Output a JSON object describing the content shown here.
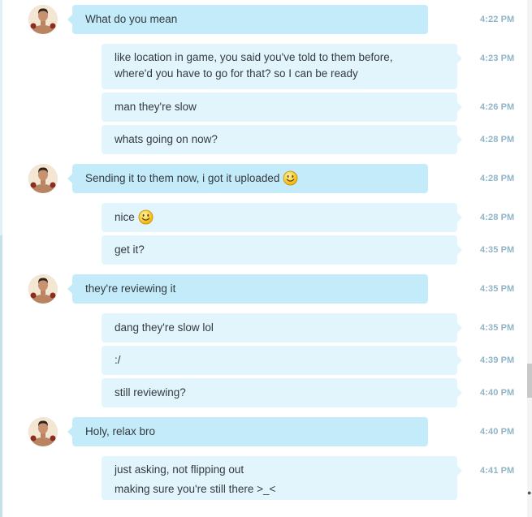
{
  "messages": [
    {
      "dir": "in",
      "time": "4:22 PM",
      "lines": [
        "What do you mean"
      ]
    },
    {
      "dir": "out",
      "time": "4:23 PM",
      "lines": [
        "like location in game, you said you've told to them before,",
        "where'd you have to go for that? so I can be ready"
      ]
    },
    {
      "dir": "out",
      "time": "4:26 PM",
      "lines": [
        "man they're slow"
      ]
    },
    {
      "dir": "out",
      "time": "4:28 PM",
      "lines": [
        "whats going on now?"
      ]
    },
    {
      "dir": "in",
      "time": "4:28 PM",
      "lines": [
        "Sending it to them now, i got it uploaded"
      ],
      "emoticon": "smile-emoticon"
    },
    {
      "dir": "out",
      "time": "4:28 PM",
      "lines": [
        "nice"
      ],
      "emoticon": "smile-emoticon"
    },
    {
      "dir": "out",
      "time": "4:35 PM",
      "lines": [
        "get it?"
      ]
    },
    {
      "dir": "in",
      "time": "4:35 PM",
      "lines": [
        "they're reviewing it"
      ]
    },
    {
      "dir": "out",
      "time": "4:35 PM",
      "lines": [
        "dang they're slow lol"
      ]
    },
    {
      "dir": "out",
      "time": "4:39 PM",
      "lines": [
        ":/"
      ]
    },
    {
      "dir": "out",
      "time": "4:40 PM",
      "lines": [
        "still reviewing?"
      ]
    },
    {
      "dir": "in",
      "time": "4:40 PM",
      "lines": [
        "Holy, relax bro"
      ]
    },
    {
      "dir": "out",
      "time": "4:41 PM",
      "lines": [
        "just asking, not flipping out",
        "making sure you're still there >_<"
      ]
    }
  ],
  "colors": {
    "incoming_bubble": "#c4ebfa",
    "outgoing_bubble": "#e2f5fc",
    "timestamp": "#8fb4c6",
    "text": "#333a40"
  },
  "icons": {
    "avatar": "contact-avatar-photo",
    "emoticon": "smile-emoticon"
  }
}
